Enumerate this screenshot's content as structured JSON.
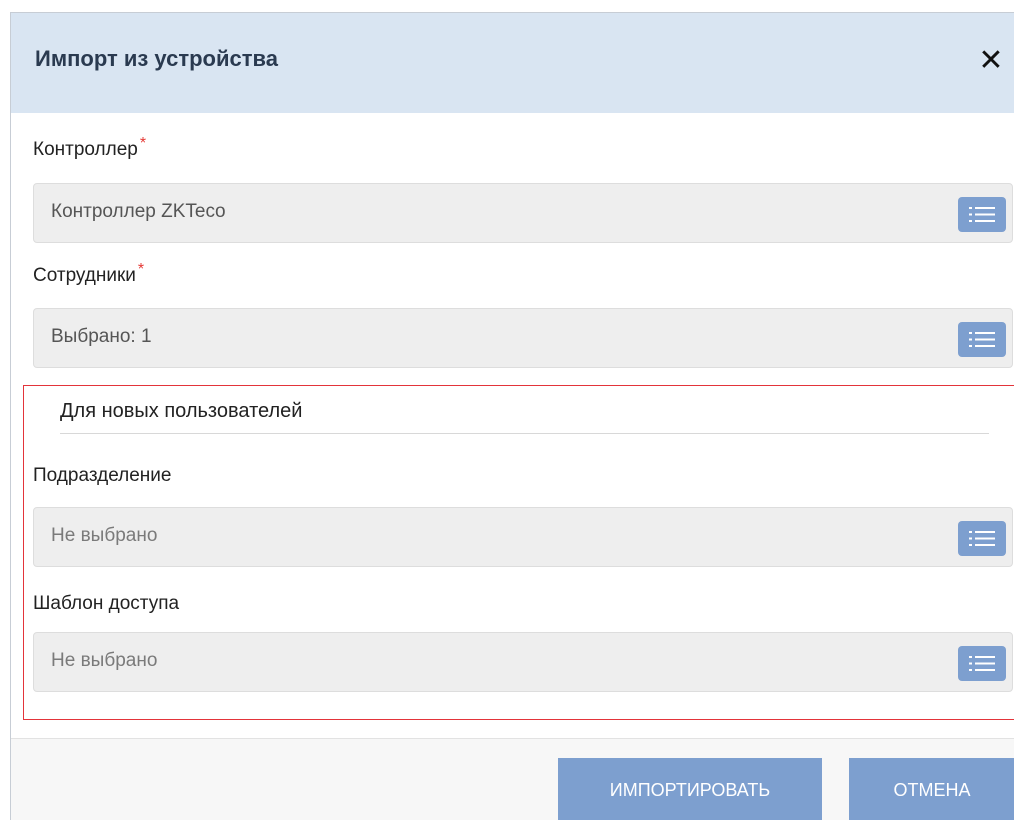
{
  "dialog": {
    "title": "Импорт из устройства",
    "close_icon": "close-icon"
  },
  "fields": {
    "controller": {
      "label": "Контроллер",
      "required_mark": "*",
      "value": "Контроллер ZKTeco",
      "button_icon": "list-icon"
    },
    "employees": {
      "label": "Сотрудники",
      "required_mark": "*",
      "value": "Выбрано: 1",
      "button_icon": "list-icon"
    }
  },
  "new_users": {
    "title": "Для новых пользователей",
    "department": {
      "label": "Подразделение",
      "value": "Не выбрано",
      "button_icon": "list-icon"
    },
    "access_template": {
      "label": "Шаблон доступа",
      "value": "Не выбрано",
      "button_icon": "list-icon"
    }
  },
  "footer": {
    "import_label": "ИМПОРТИРОВАТЬ",
    "cancel_label": "ОТМЕНА"
  },
  "colors": {
    "header_bg": "#d9e5f2",
    "accent": "#7d9fcf",
    "required": "#e53935",
    "highlight_border": "#e3343a"
  }
}
